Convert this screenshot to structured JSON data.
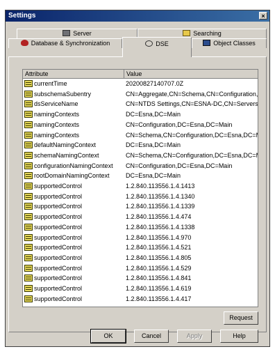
{
  "window": {
    "title": "Settings",
    "close_label": "×"
  },
  "tabs": {
    "server": {
      "label": "Server",
      "icon": "server-icon"
    },
    "searching": {
      "label": "Searching",
      "icon": "search-icon"
    },
    "database": {
      "label": "Database & Synchronization",
      "icon": "database-icon"
    },
    "dse": {
      "label": "DSE",
      "icon": "dse-icon"
    },
    "object_classes": {
      "label": "Object Classes",
      "icon": "object-classes-icon"
    }
  },
  "grid": {
    "columns": [
      "Attribute",
      "Value"
    ],
    "rows": [
      {
        "attribute": "currentTime",
        "value": "20200827140707.0Z"
      },
      {
        "attribute": "subschemaSubentry",
        "value": "CN=Aggregate,CN=Schema,CN=Configuration,D"
      },
      {
        "attribute": "dsServiceName",
        "value": "CN=NTDS Settings,CN=ESNA-DC,CN=Servers,"
      },
      {
        "attribute": "namingContexts",
        "value": "DC=Esna,DC=Main"
      },
      {
        "attribute": "namingContexts",
        "value": "CN=Configuration,DC=Esna,DC=Main"
      },
      {
        "attribute": "namingContexts",
        "value": "CN=Schema,CN=Configuration,DC=Esna,DC=M"
      },
      {
        "attribute": "defaultNamingContext",
        "value": "DC=Esna,DC=Main"
      },
      {
        "attribute": "schemaNamingContext",
        "value": "CN=Schema,CN=Configuration,DC=Esna,DC=M"
      },
      {
        "attribute": "configurationNamingContext",
        "value": "CN=Configuration,DC=Esna,DC=Main"
      },
      {
        "attribute": "rootDomainNamingContext",
        "value": "DC=Esna,DC=Main"
      },
      {
        "attribute": "supportedControl",
        "value": "1.2.840.113556.1.4.1413"
      },
      {
        "attribute": "supportedControl",
        "value": "1.2.840.113556.1.4.1340"
      },
      {
        "attribute": "supportedControl",
        "value": "1.2.840.113556.1.4.1339"
      },
      {
        "attribute": "supportedControl",
        "value": "1.2.840.113556.1.4.474"
      },
      {
        "attribute": "supportedControl",
        "value": "1.2.840.113556.1.4.1338"
      },
      {
        "attribute": "supportedControl",
        "value": "1.2.840.113556.1.4.970"
      },
      {
        "attribute": "supportedControl",
        "value": "1.2.840.113556.1.4.521"
      },
      {
        "attribute": "supportedControl",
        "value": "1.2.840.113556.1.4.805"
      },
      {
        "attribute": "supportedControl",
        "value": "1.2.840.113556.1.4.529"
      },
      {
        "attribute": "supportedControl",
        "value": "1.2.840.113556.1.4.841"
      },
      {
        "attribute": "supportedControl",
        "value": "1.2.840.113556.1.4.619"
      },
      {
        "attribute": "supportedControl",
        "value": "1.2.840.113556.1.4.417"
      }
    ]
  },
  "buttons": {
    "request": "Request",
    "ok": "OK",
    "cancel": "Cancel",
    "apply": "Apply",
    "help": "Help"
  },
  "colors": {
    "titlebar": "#0a246a",
    "dialog": "#d4d0c8"
  }
}
